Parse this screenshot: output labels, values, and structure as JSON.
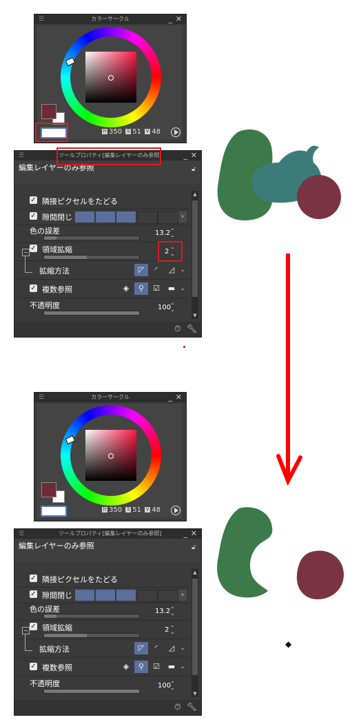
{
  "color_circle": {
    "title": "カラーサークル",
    "h": "350",
    "s": "51",
    "v": "48",
    "h_icon": "H",
    "s_icon": "S",
    "v_icon": "V",
    "main_color": "#6e2a35",
    "sub_color": "#ffffff"
  },
  "tool_property": {
    "title": "ツールプロパティ[編集レイヤーのみ参照]",
    "header": "編集レイヤーのみ参照",
    "items": {
      "adjacent_pixel": "隣接ピクセルをたどる",
      "close_gap": "隙間閉じ",
      "color_margin": "色の誤差",
      "color_margin_value": "13.2",
      "area_scaling": "領域拡縮",
      "area_scaling_value": "2",
      "scaling_method": "拡縮方法",
      "multi_ref": "複数参照",
      "opacity": "不透明度",
      "opacity_value": "100"
    },
    "color_margin_fraction": 0.132,
    "opacity_fraction": 1.0
  },
  "colors": {
    "accent": "#5a6f9c",
    "red_annotation": "#e0191b",
    "green_blob": "#3c7a4a",
    "teal_blob": "#3d7b7a",
    "maroon_blob": "#7a3343"
  },
  "icons": [
    "settings-icon",
    "wrench-icon",
    "lock-icon",
    "paint-bucket-icon",
    "arrow-down-icon"
  ]
}
